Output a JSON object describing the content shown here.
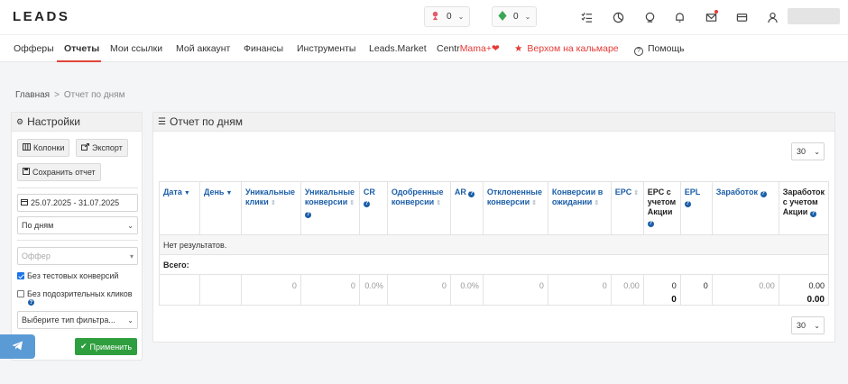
{
  "brand": {
    "logo": "LEADS"
  },
  "top_counters": [
    {
      "value": "0",
      "icon": "rank-icon"
    },
    {
      "value": "0",
      "icon": "gem-icon"
    }
  ],
  "nav": {
    "items": [
      "Офферы",
      "Отчеты",
      "Мои ссылки",
      "Мой аккаунт",
      "Финансы",
      "Инструменты",
      "Leads.Market"
    ],
    "centr_prefix": "Centr",
    "centr_suffix": "Mama+",
    "promo": "Верхом на кальмаре",
    "help": "Помощь",
    "active": "Отчеты"
  },
  "breadcrumb": {
    "home": "Главная",
    "sep": ">",
    "current": "Отчет по дням"
  },
  "settings": {
    "title": "Настройки",
    "columns_button": "Колонки",
    "export_button": "Экспорт",
    "save_button": "Сохранить отчет",
    "date_range": "25.07.2025 - 31.07.2025",
    "group_by": "По дням",
    "offer_placeholder": "Оффер",
    "no_test_label": "Без тестовых конверсий",
    "no_test_checked": true,
    "no_suspicious_label": "Без подозрительных кликов",
    "no_suspicious_checked": false,
    "filter_type": "Выберите тип фильтра...",
    "apply_button": "Применить"
  },
  "report": {
    "title": "Отчет по дням",
    "per_page_top": "30",
    "per_page_bottom": "30",
    "columns": [
      {
        "label": "Дата",
        "sort": "desc",
        "help": false
      },
      {
        "label": "День",
        "sort": "desc",
        "help": false
      },
      {
        "label": "Уникальные клики",
        "sort": "both",
        "help": false
      },
      {
        "label": "Уникальные конверсии",
        "sort": "both",
        "help": true
      },
      {
        "label": "CR",
        "sort": "none",
        "help": true
      },
      {
        "label": "Одобренные конверсии",
        "sort": "both",
        "help": false
      },
      {
        "label": "AR",
        "sort": "none",
        "help": true
      },
      {
        "label": "Отклоненные конверсии",
        "sort": "both",
        "help": false
      },
      {
        "label": "Конверсии в ожидании",
        "sort": "both",
        "help": false
      },
      {
        "label": "EPC",
        "sort": "both",
        "help": false
      },
      {
        "label": "EPC с учетом Акции",
        "sort": "none",
        "help": true
      },
      {
        "label": "EPL",
        "sort": "none",
        "help": true
      },
      {
        "label": "Заработок",
        "sort": "none",
        "help": true
      },
      {
        "label": "Заработок с учетом Акции",
        "sort": "none",
        "help": true
      }
    ],
    "no_results": "Нет результатов.",
    "total_label": "Всего:",
    "totals": {
      "unique_clicks": "0",
      "unique_conversions": "0",
      "cr": "0.0%",
      "approved": "0",
      "ar": "0.0%",
      "rejected": "0",
      "pending": "0",
      "epc": "0.00",
      "epc_promo": "0",
      "epc_promo_bold": "0",
      "epl": "0",
      "earnings": "0.00",
      "earnings_promo": "0.00",
      "earnings_promo_bold": "0.00"
    }
  },
  "colors": {
    "accent": "#e0463a",
    "link": "#1b5ea8",
    "apply": "#2e9e3e",
    "telegram": "#5b9bd5"
  }
}
